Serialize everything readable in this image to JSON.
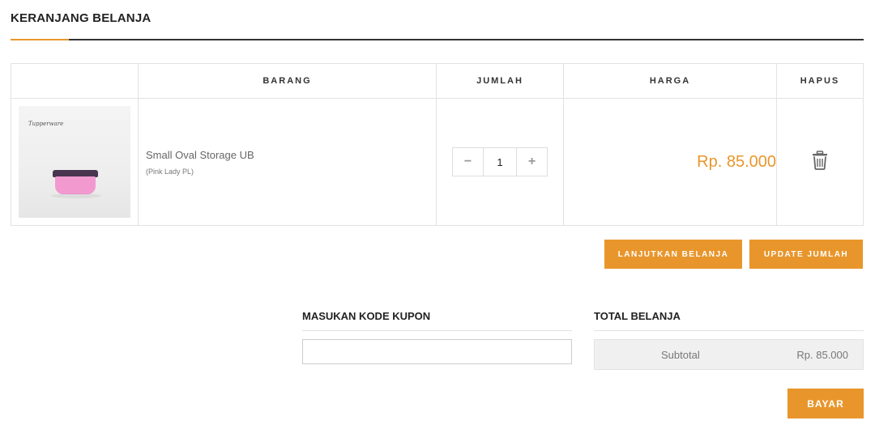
{
  "page": {
    "title": "KERANJANG BELANJA"
  },
  "colors": {
    "accent": "#e8962c"
  },
  "table": {
    "headers": {
      "item": "BARANG",
      "quantity": "JUMLAH",
      "price": "HARGA",
      "delete": "HAPUS"
    },
    "rows": [
      {
        "name": "Small Oval Storage UB",
        "variant": "(Pink Lady PL)",
        "thumb_logo": "Tupperware",
        "quantity": "1",
        "price": "Rp. 85.000",
        "minus_icon": "−",
        "plus_icon": "+"
      }
    ]
  },
  "actions": {
    "continue_label": "LANJUTKAN BELANJA",
    "update_label": "UPDATE JUMLAH"
  },
  "coupon": {
    "title": "MASUKAN KODE KUPON",
    "value": "",
    "placeholder": ""
  },
  "totals": {
    "title": "TOTAL BELANJA",
    "subtotal_label": "Subtotal",
    "subtotal_value": "Rp. 85.000"
  },
  "checkout": {
    "pay_label": "BAYAR"
  },
  "icons": {
    "delete": "trash-icon"
  }
}
